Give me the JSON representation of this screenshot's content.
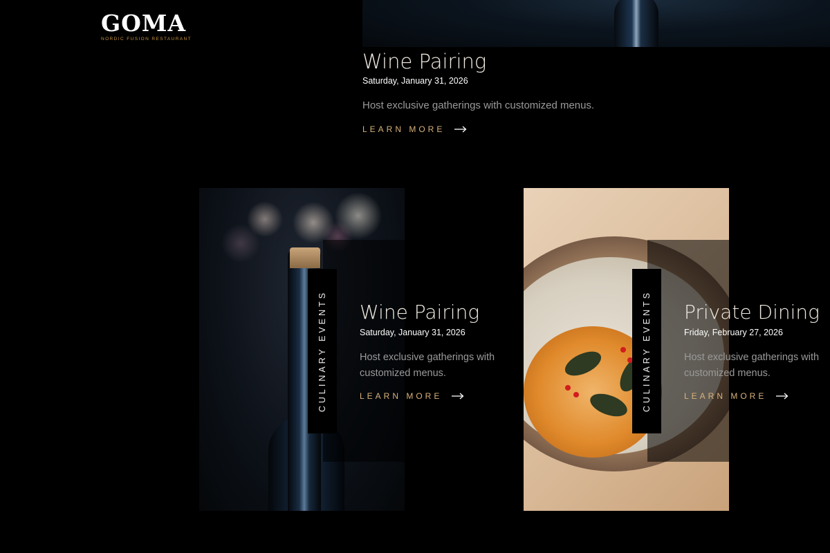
{
  "brand": {
    "name": "GOMA",
    "tagline": "NORDIC FUSION RESTAURANT",
    "accent": "#c8913f"
  },
  "top_event": {
    "title": "Wine Pairing",
    "date": "Saturday, January 31, 2026",
    "description": "Host exclusive gatherings with customized menus.",
    "cta": "LEARN MORE"
  },
  "cards": [
    {
      "category": "CULINARY EVENTS",
      "title": "Wine Pairing",
      "date": "Saturday, January 31, 2026",
      "description": "Host exclusive gatherings with customized menus.",
      "cta": "LEARN MORE",
      "image": "champagne-bottle-image"
    },
    {
      "category": "CULINARY EVENTS",
      "title": "Private Dining",
      "date": "Friday, February 27, 2026",
      "description": "Host exclusive gatherings with customized menus.",
      "cta": "LEARN MORE",
      "image": "plated-dish-image"
    }
  ],
  "colors": {
    "background": "#000000",
    "cta": "#d9b27a",
    "muted_text": "#9a9a9a"
  },
  "icons": {
    "cta_arrow": "arrow-right-icon"
  }
}
